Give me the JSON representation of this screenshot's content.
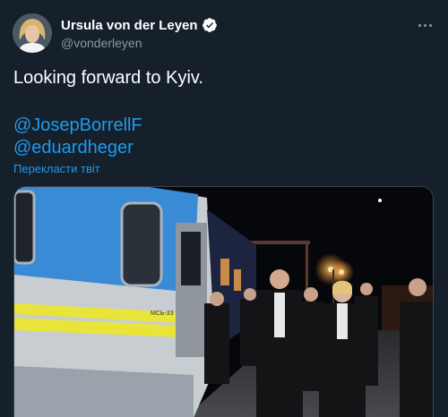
{
  "author": {
    "display_name": "Ursula von der Leyen",
    "handle": "@vonderleyen",
    "verified_icon": "verified-badge-icon",
    "avatar_icon": "profile-photo"
  },
  "tweet": {
    "text": "Looking forward to Kyiv.",
    "mentions": [
      "@JosepBorrellF",
      "@eduardheger"
    ],
    "translate_label": "Перекласти твіт"
  },
  "media": {
    "type": "photo",
    "description_icon": "train-platform-photo",
    "car_label": "МСЬ-33"
  },
  "colors": {
    "background": "#15202b",
    "link": "#1d9bf0",
    "secondary_text": "#8b98a5",
    "verified": "#1d9bf0"
  }
}
